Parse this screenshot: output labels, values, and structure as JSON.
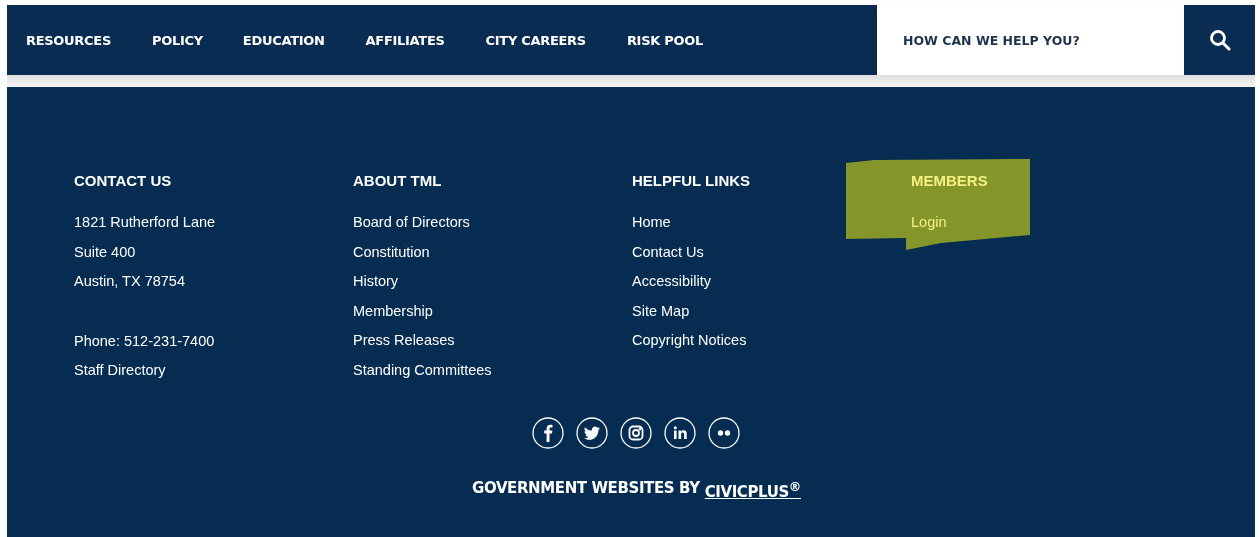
{
  "nav": {
    "items": [
      {
        "label": "RESOURCES"
      },
      {
        "label": "POLICY"
      },
      {
        "label": "EDUCATION"
      },
      {
        "label": "AFFILIATES"
      },
      {
        "label": "CITY CAREERS"
      },
      {
        "label": "RISK POOL"
      }
    ],
    "search": {
      "placeholder": "HOW CAN WE HELP YOU?"
    }
  },
  "footer": {
    "columns": [
      {
        "heading": "CONTACT US",
        "highlighted": false,
        "groups": [
          [
            "1821 Rutherford Lane",
            "Suite 400",
            "Austin, TX 78754"
          ],
          [
            "Phone: 512-231-7400",
            "Staff Directory"
          ]
        ]
      },
      {
        "heading": "ABOUT TML",
        "highlighted": false,
        "groups": [
          [
            "Board of Directors",
            "Constitution",
            "History",
            "Membership",
            "Press Releases",
            "Standing Committees"
          ]
        ]
      },
      {
        "heading": "HELPFUL LINKS",
        "highlighted": false,
        "groups": [
          [
            "Home",
            "Contact Us",
            "Accessibility",
            "Site Map",
            "Copyright Notices"
          ]
        ]
      },
      {
        "heading": "MEMBERS",
        "highlighted": true,
        "groups": [
          [
            "Login"
          ]
        ]
      }
    ],
    "social": [
      {
        "kind": "facebook"
      },
      {
        "kind": "twitter"
      },
      {
        "kind": "instagram"
      },
      {
        "kind": "linkedin"
      },
      {
        "kind": "flickr"
      }
    ],
    "credit": {
      "text": "GOVERNMENT WEBSITES BY",
      "link": "CIVICPLUS$^{®}$"
    }
  }
}
